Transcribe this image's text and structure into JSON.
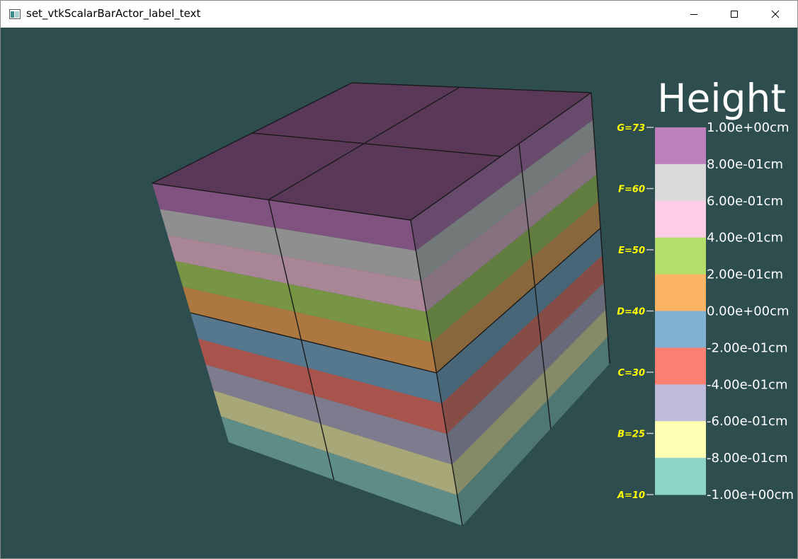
{
  "window": {
    "title": "set_vtkScalarBarActor_label_text",
    "icon": "vtk-app-icon",
    "controls": [
      "minimize-icon",
      "maximize-icon",
      "close-icon"
    ]
  },
  "viewport": {
    "background": "#2e4d4f"
  },
  "scalar_bar": {
    "title": "Height",
    "range": [
      -1.0,
      1.0
    ],
    "tick_labels": [
      "1.00e+00cm",
      "8.00e-01cm",
      "6.00e-01cm",
      "4.00e-01cm",
      "2.00e-01cm",
      "0.00e+00cm",
      "-2.00e-01cm",
      "-4.00e-01cm",
      "-6.00e-01cm",
      "-8.00e-01cm",
      "-1.00e+00cm"
    ],
    "colors_top_to_bottom": [
      "#bd80bd",
      "#d9d9d9",
      "#fccde5",
      "#b3de69",
      "#fdb462",
      "#80b1d3",
      "#fb8072",
      "#bebada",
      "#ffffb3",
      "#8dd3c7"
    ],
    "annotations_top_to_bottom": [
      "G=73",
      "F=60",
      "E=50",
      "D=40",
      "C=30",
      "B=25",
      "A=10"
    ],
    "annotation_color": "#ffff00",
    "label_color": "#ffffff"
  },
  "cube": {
    "band_colors_top_to_bottom": [
      "#7f527f",
      "#8f8f8f",
      "#a88696",
      "#779544",
      "#ac7840",
      "#56788f",
      "#a8544d",
      "#7f7b8f",
      "#a8a778",
      "#5e8c86"
    ],
    "top_face_color": "#5a3858"
  }
}
